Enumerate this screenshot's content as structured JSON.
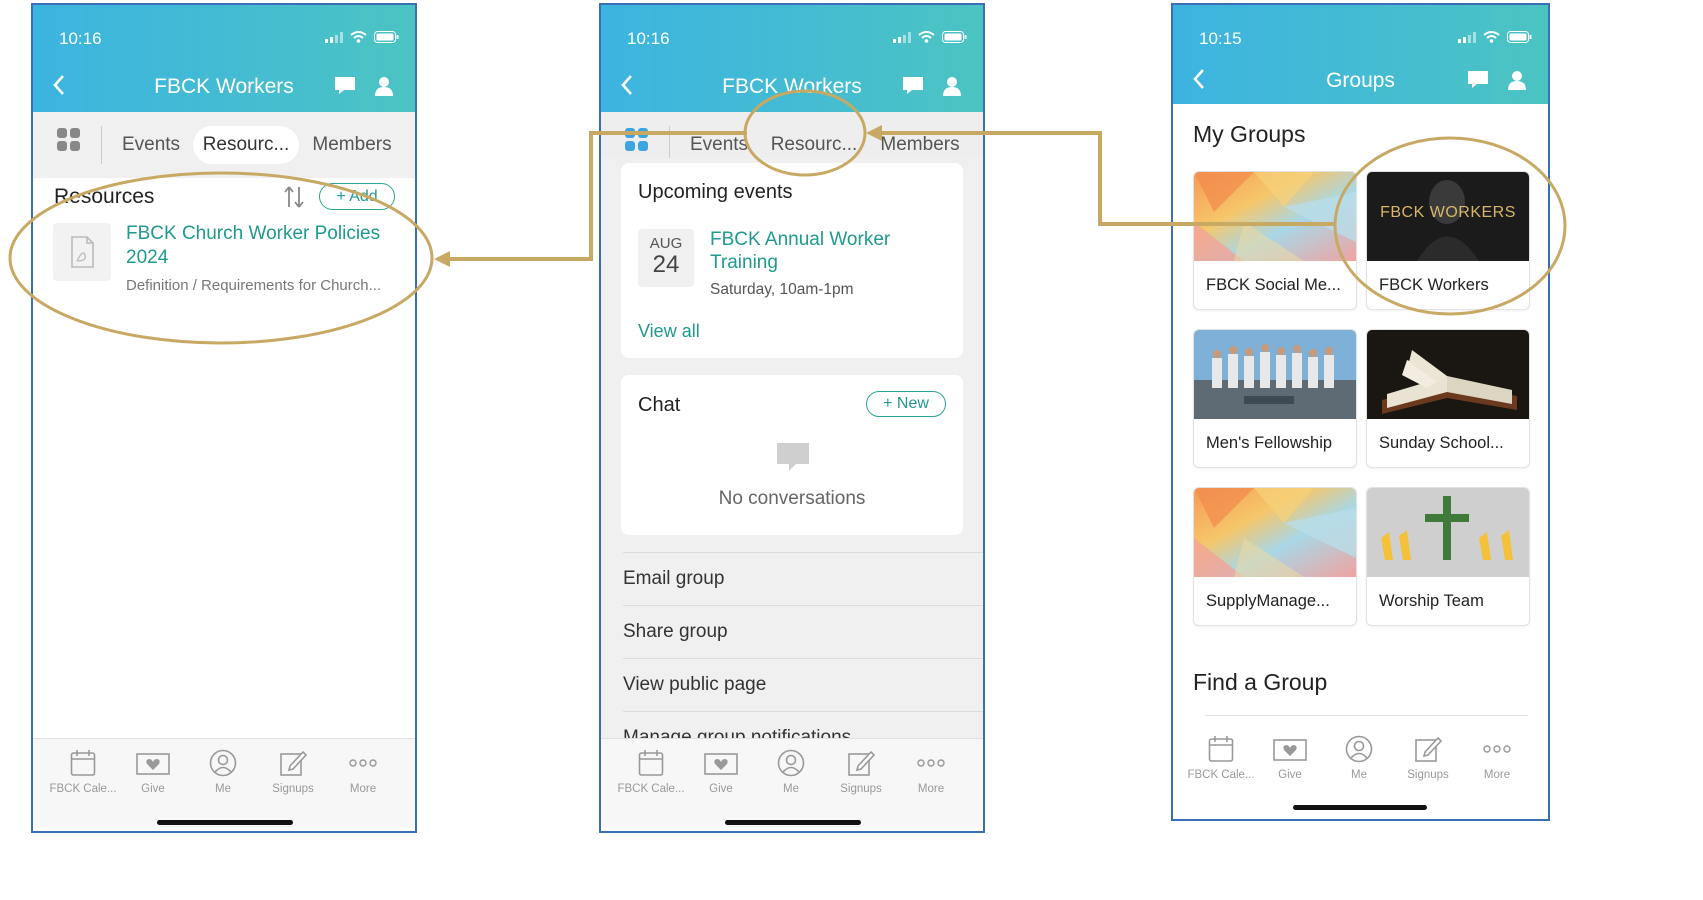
{
  "accent_teal": "#1f9a8c",
  "header_gradient": [
    "#3cb4e0",
    "#4cc4c2"
  ],
  "annotation_color": "#c8a964",
  "phone1": {
    "time": "10:16",
    "title": "FBCK Workers",
    "tabs": [
      "Events",
      "Resourc...",
      "Members"
    ],
    "active_tab": "Resourc...",
    "section_title": "Resources",
    "add_label": "+ Add",
    "resource": {
      "title_line1": "FBCK Church Worker Policies",
      "title_line2": "2024",
      "subtitle": "Definition / Requirements for Church..."
    }
  },
  "phone2": {
    "time": "10:16",
    "title": "FBCK Workers",
    "tabs": [
      "Events",
      "Resourc...",
      "Members"
    ],
    "upcoming": {
      "heading": "Upcoming events",
      "month": "AUG",
      "day": "24",
      "event_line1": "FBCK Annual Worker",
      "event_line2": "Training",
      "when": "Saturday, 10am-1pm",
      "view_all": "View all"
    },
    "chat": {
      "heading": "Chat",
      "new_label": "+ New",
      "empty": "No conversations"
    },
    "menu": [
      "Email group",
      "Share group",
      "View public page",
      "Manage group notifications"
    ]
  },
  "phone3": {
    "time": "10:15",
    "title": "Groups",
    "my_groups": "My Groups",
    "groups": [
      {
        "name": "FBCK Social Me...",
        "image": "low-poly-gradient"
      },
      {
        "name": "FBCK Workers",
        "image": "dark-photo",
        "overlay": "FBCK WORKERS"
      },
      {
        "name": "Men's Fellowship",
        "image": "group-photo"
      },
      {
        "name": "Sunday School...",
        "image": "open-bible"
      },
      {
        "name": "SupplyManage...",
        "image": "low-poly-gradient"
      },
      {
        "name": "Worship Team",
        "image": "cross-with-figures"
      }
    ],
    "find_group": "Find a Group"
  },
  "bottom_nav": [
    {
      "label": "FBCK Cale...",
      "icon": "calendar-icon"
    },
    {
      "label": "Give",
      "icon": "give-icon"
    },
    {
      "label": "Me",
      "icon": "profile-icon"
    },
    {
      "label": "Signups",
      "icon": "signup-icon"
    },
    {
      "label": "More",
      "icon": "more-icon"
    }
  ]
}
